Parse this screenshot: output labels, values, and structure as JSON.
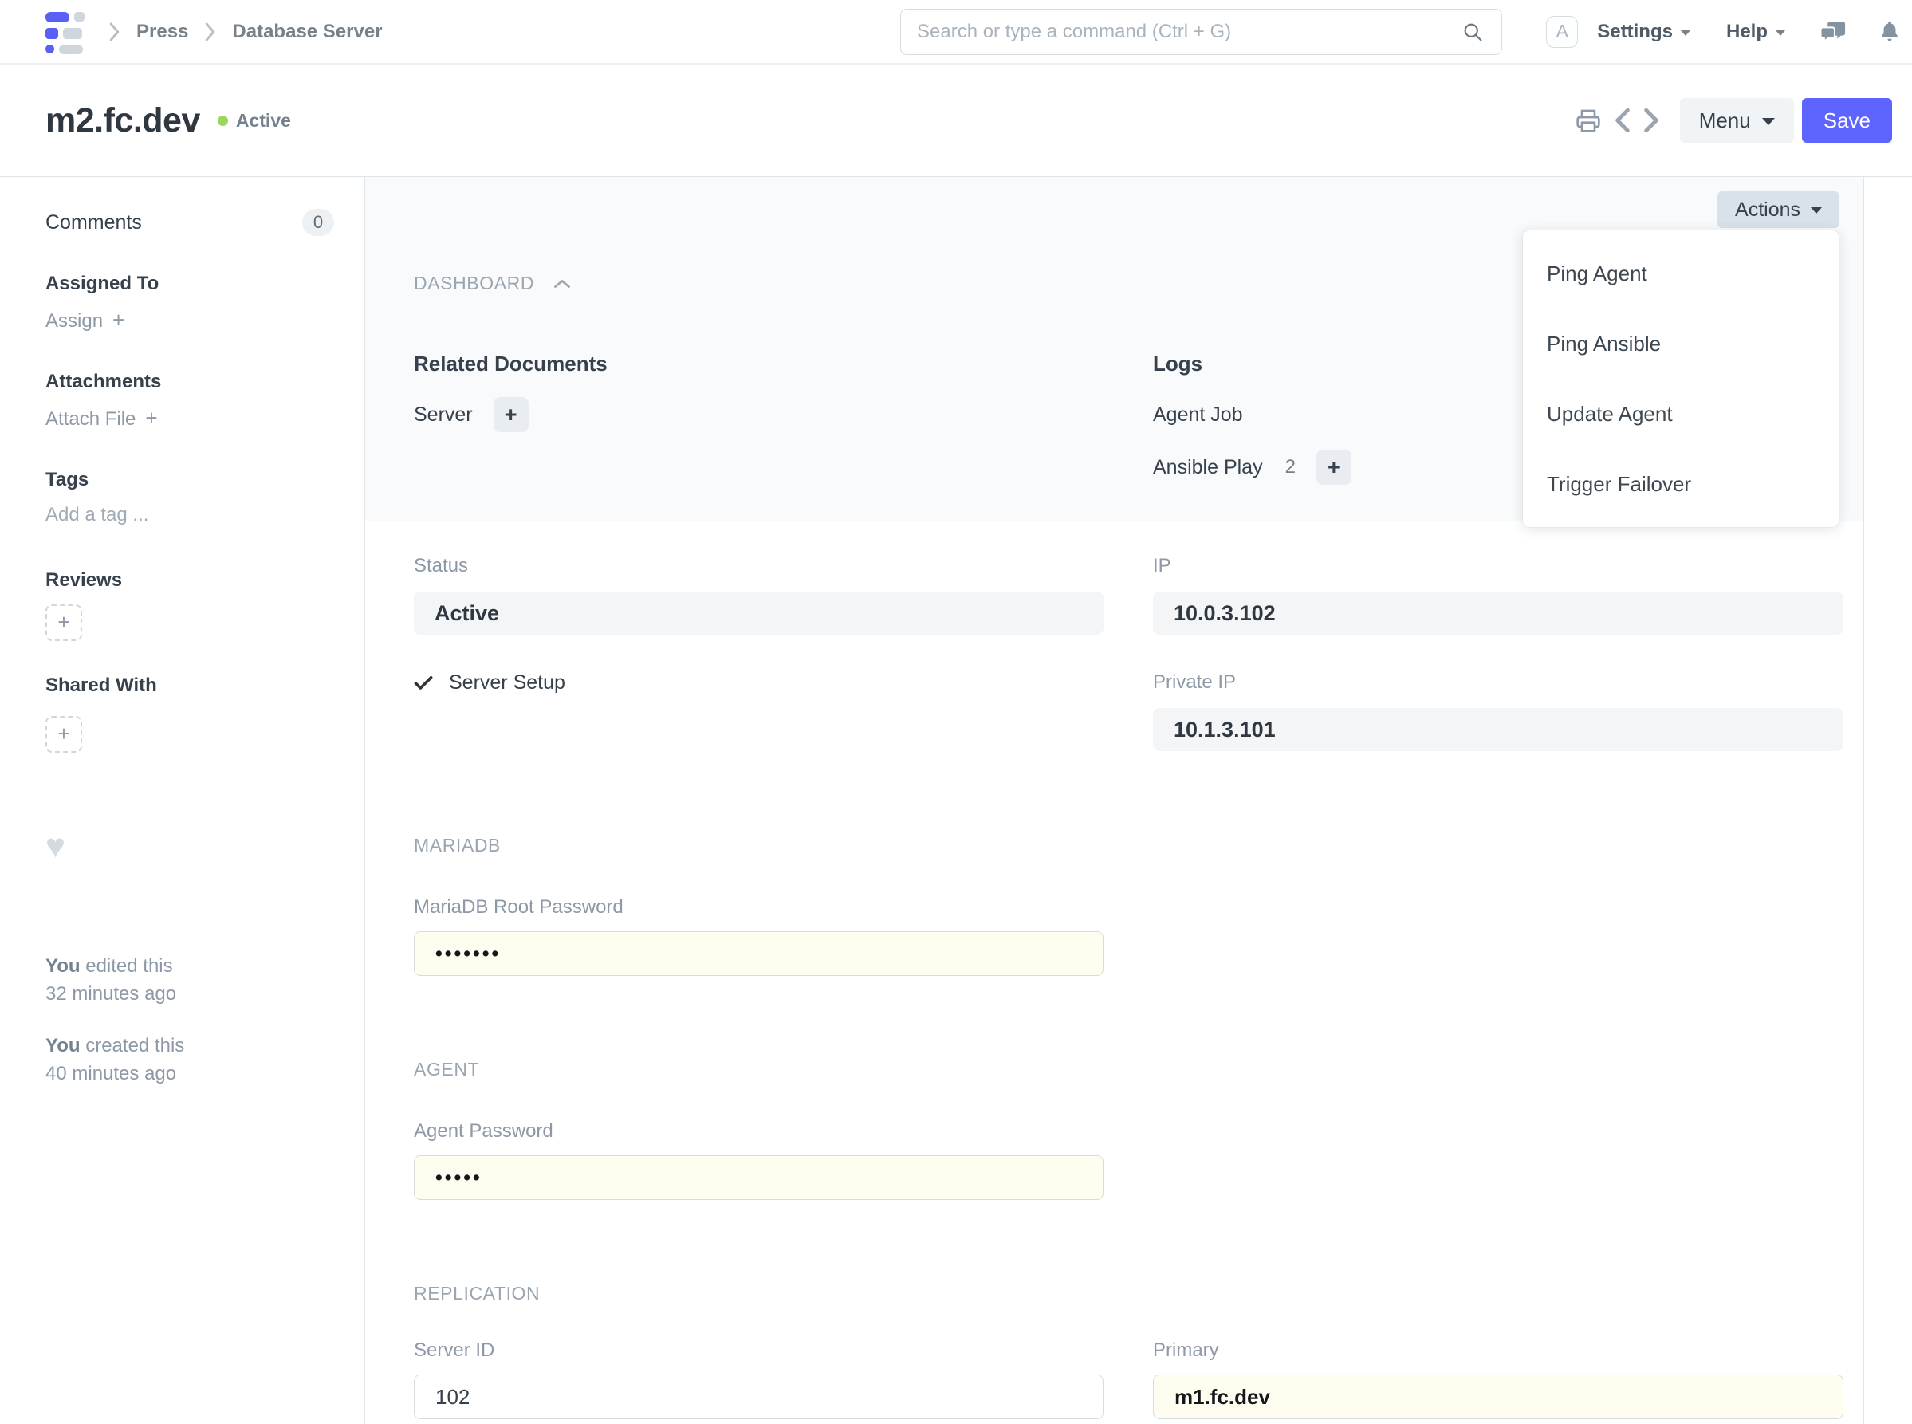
{
  "colors": {
    "primary": "#5e64ff",
    "indicator_green": "#98d85b",
    "password_field_bg": "#fffcf0",
    "disabled_field_bg": "#f3f5f7",
    "actions_btn_bg": "#d8e2ea"
  },
  "navbar": {
    "breadcrumbs": [
      {
        "label": "Press"
      },
      {
        "label": "Database Server"
      }
    ],
    "search": {
      "placeholder": "Search or type a command (Ctrl + G)"
    },
    "avatar_letter": "A",
    "settings_label": "Settings",
    "help_label": "Help"
  },
  "page_head": {
    "title": "m2.fc.dev",
    "status": "Active",
    "menu_label": "Menu",
    "save_label": "Save"
  },
  "toolbar": {
    "actions_label": "Actions"
  },
  "actions_menu": {
    "items": [
      {
        "label": "Ping Agent"
      },
      {
        "label": "Ping Ansible"
      },
      {
        "label": "Update Agent"
      },
      {
        "label": "Trigger Failover"
      }
    ]
  },
  "sidebar": {
    "comments_label": "Comments",
    "comments_count": "0",
    "assigned_to_label": "Assigned To",
    "assign_label": "Assign",
    "attachments_label": "Attachments",
    "attach_file_label": "Attach File",
    "tags_label": "Tags",
    "add_tag_label": "Add a tag ...",
    "reviews_label": "Reviews",
    "shared_with_label": "Shared With",
    "edited": {
      "who": "You",
      "action": "edited this",
      "when": "32 minutes ago"
    },
    "created": {
      "who": "You",
      "action": "created this",
      "when": "40 minutes ago"
    }
  },
  "dashboard": {
    "heading": "DASHBOARD",
    "related_documents_heading": "Related Documents",
    "server_link": "Server",
    "logs_heading": "Logs",
    "agent_job_link": "Agent Job",
    "ansible_play_link": "Ansible Play",
    "ansible_play_count": "2"
  },
  "form": {
    "status_label": "Status",
    "status_value": "Active",
    "server_setup_label": "Server Setup",
    "ip_label": "IP",
    "ip_value": "10.0.3.102",
    "private_ip_label": "Private IP",
    "private_ip_value": "10.1.3.101",
    "mariadb_heading": "MARIADB",
    "mariadb_root_password_label": "MariaDB Root Password",
    "mariadb_root_password_value": "•••••••",
    "agent_heading": "AGENT",
    "agent_password_label": "Agent Password",
    "agent_password_value": "•••••",
    "replication_heading": "REPLICATION",
    "server_id_label": "Server ID",
    "server_id_value": "102",
    "primary_label": "Primary",
    "primary_value": "m1.fc.dev"
  }
}
